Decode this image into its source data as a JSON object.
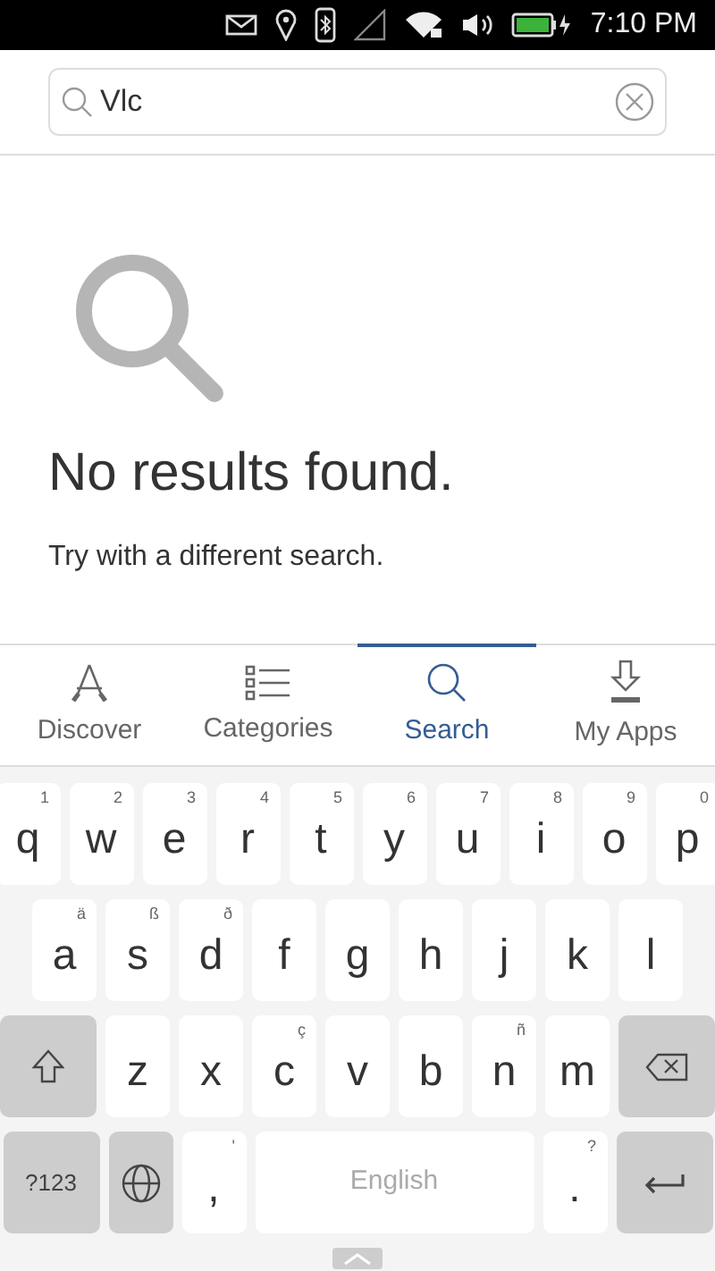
{
  "status_bar": {
    "time": "7:10 PM",
    "battery": {
      "charging": true
    }
  },
  "search": {
    "value": "Vlc"
  },
  "empty_state": {
    "title": "No results found.",
    "message": "Try with a different search."
  },
  "tabs": [
    {
      "label": "Discover",
      "kind": "discover",
      "selected": false
    },
    {
      "label": "Categories",
      "kind": "categories",
      "selected": false
    },
    {
      "label": "Search",
      "kind": "search",
      "selected": true
    },
    {
      "label": "My Apps",
      "kind": "myapps",
      "selected": false
    }
  ],
  "keyboard": {
    "rows": [
      {
        "keys": [
          {
            "kind": "letter",
            "label": "q",
            "hint": "1"
          },
          {
            "kind": "letter",
            "label": "w",
            "hint": "2"
          },
          {
            "kind": "letter",
            "label": "e",
            "hint": "3"
          },
          {
            "kind": "letter",
            "label": "r",
            "hint": "4"
          },
          {
            "kind": "letter",
            "label": "t",
            "hint": "5"
          },
          {
            "kind": "letter",
            "label": "y",
            "hint": "6"
          },
          {
            "kind": "letter",
            "label": "u",
            "hint": "7"
          },
          {
            "kind": "letter",
            "label": "i",
            "hint": "8"
          },
          {
            "kind": "letter",
            "label": "o",
            "hint": "9"
          },
          {
            "kind": "letter",
            "label": "p",
            "hint": "0"
          }
        ]
      },
      {
        "keys": [
          {
            "kind": "letter",
            "label": "a",
            "hint": "ä"
          },
          {
            "kind": "letter",
            "label": "s",
            "hint": "ß"
          },
          {
            "kind": "letter",
            "label": "d",
            "hint": "ð"
          },
          {
            "kind": "letter",
            "label": "f"
          },
          {
            "kind": "letter",
            "label": "g"
          },
          {
            "kind": "letter",
            "label": "h"
          },
          {
            "kind": "letter",
            "label": "j"
          },
          {
            "kind": "letter",
            "label": "k"
          },
          {
            "kind": "letter",
            "label": "l"
          }
        ]
      },
      {
        "keys": [
          {
            "kind": "shift"
          },
          {
            "kind": "letter",
            "label": "z"
          },
          {
            "kind": "letter",
            "label": "x"
          },
          {
            "kind": "letter",
            "label": "c",
            "hint": "ç"
          },
          {
            "kind": "letter",
            "label": "v"
          },
          {
            "kind": "letter",
            "label": "b"
          },
          {
            "kind": "letter",
            "label": "n",
            "hint": "ñ"
          },
          {
            "kind": "letter",
            "label": "m"
          },
          {
            "kind": "backspace"
          }
        ]
      },
      {
        "keys": [
          {
            "kind": "symbols",
            "label": "?123"
          },
          {
            "kind": "globe"
          },
          {
            "kind": "letter",
            "label": ",",
            "hint": "'"
          },
          {
            "kind": "space",
            "label": "English"
          },
          {
            "kind": "letter",
            "label": ".",
            "hint": "?"
          },
          {
            "kind": "enter"
          }
        ]
      }
    ]
  }
}
